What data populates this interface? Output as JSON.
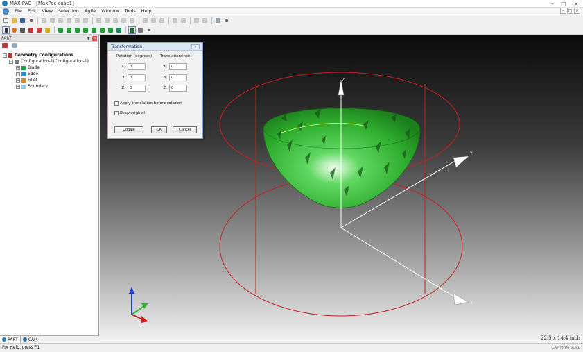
{
  "window": {
    "title": "MAX-PAC - [MaxPac case1]"
  },
  "menu": [
    "File",
    "Edit",
    "View",
    "Selection",
    "Agile",
    "Window",
    "Tools",
    "Help"
  ],
  "panel": {
    "title": "PART",
    "tree": {
      "root": "Geometry Configurations",
      "config": "Configuration-1(Configuration-1)",
      "items": [
        "Blade",
        "Edge",
        "Fillet",
        "Boundary"
      ]
    },
    "tabs": [
      "PART",
      "CAM"
    ]
  },
  "dialog": {
    "title": "Transformation",
    "rotation_label": "Rotation (degrees)",
    "translation_label": "Translation(inch)",
    "axis_labels": [
      "X:",
      "Y:",
      "Z:"
    ],
    "rotation": [
      "0",
      "0",
      "0"
    ],
    "translation": [
      "0",
      "0",
      "0"
    ],
    "apply_translation_label": "Apply translation before rotation",
    "keep_original_label": "Keep original",
    "buttons": {
      "update": "Update",
      "ok": "OK",
      "cancel": "Cancel"
    }
  },
  "viewport": {
    "dimensions": "22.5 x 14.4 inch",
    "surface_color": "#2fae2f",
    "cylinder_color": "#c82020",
    "axes": {
      "x": "X",
      "y": "Y",
      "z": "Z"
    }
  },
  "status": {
    "help": "For Help, press F1",
    "indicators": "CAP  NUM  SCRL"
  }
}
